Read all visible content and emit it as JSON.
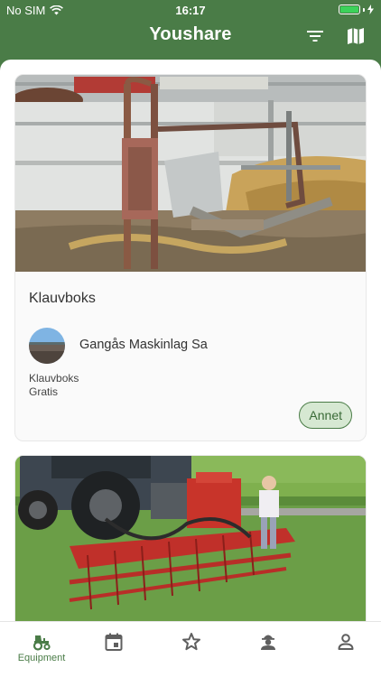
{
  "status_bar": {
    "carrier": "No SIM",
    "time": "16:17"
  },
  "header": {
    "title": "Youshare",
    "filter_icon": "filter-icon",
    "map_icon": "map-icon"
  },
  "listings": [
    {
      "title": "Klauvboks",
      "owner": "Gangås Maskinlag Sa",
      "description": "Klauvboks",
      "price": "Gratis",
      "category": "Annet"
    }
  ],
  "tabs": [
    {
      "label": "Equipment",
      "icon": "tractor-icon",
      "active": true
    },
    {
      "label": "",
      "icon": "calendar-icon"
    },
    {
      "label": "",
      "icon": "star-icon"
    },
    {
      "label": "",
      "icon": "farmer-icon"
    },
    {
      "label": "",
      "icon": "profile-icon"
    }
  ],
  "colors": {
    "primary": "#4a7c47",
    "tag_bg": "#d6e8d2"
  }
}
